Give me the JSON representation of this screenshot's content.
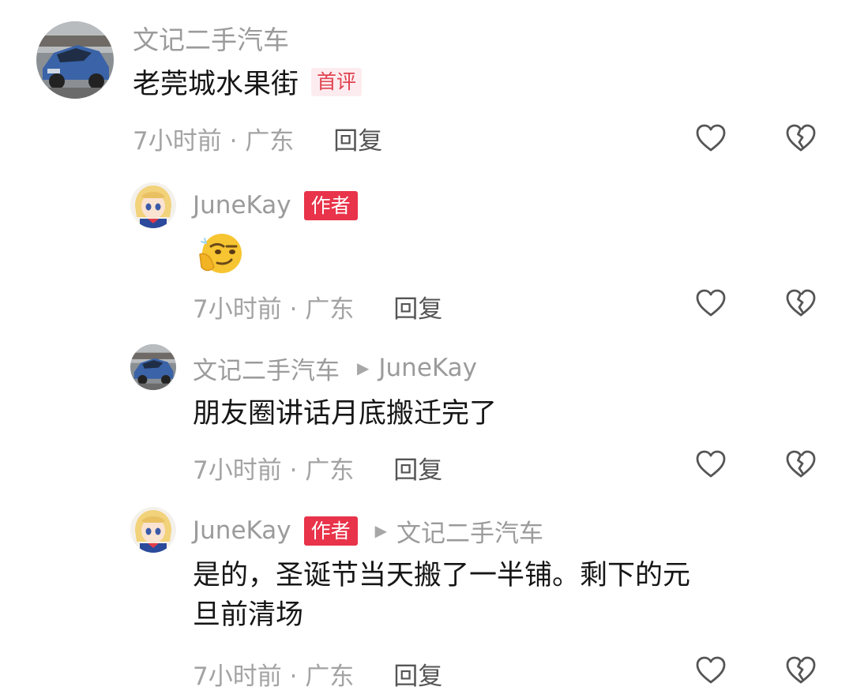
{
  "comments": [
    {
      "author": "文记二手汽车",
      "text": "老莞城水果街",
      "tag": "首评",
      "time": "7小时前 · 广东",
      "reply_label": "回复"
    }
  ],
  "replies": [
    {
      "author": "JuneKay",
      "author_tag": "作者",
      "emoji": "thinking-face-emoji",
      "time": "7小时前 · 广东",
      "reply_label": "回复"
    },
    {
      "author": "文记二手汽车",
      "reply_to": "JuneKay",
      "text": "朋友圈讲话月底搬迁完了",
      "time": "7小时前 · 广东",
      "reply_label": "回复"
    },
    {
      "author": "JuneKay",
      "author_tag": "作者",
      "reply_to": "文记二手汽车",
      "text_line1": "是的，圣诞节当天搬了一半铺。剩下的元",
      "text_line2": "旦前清场",
      "time": "7小时前 · 广东",
      "reply_label": "回复"
    }
  ],
  "icons": {
    "like": "heart-outline-icon",
    "dislike": "broken-heart-icon",
    "arrow": "triangle-right-icon"
  },
  "colors": {
    "author_tag_bg": "#e8334a",
    "first_tag_bg": "#fdecef",
    "first_tag_text": "#e0424f",
    "meta_text": "#a3a3a3",
    "name_text": "#9b9b9b"
  }
}
